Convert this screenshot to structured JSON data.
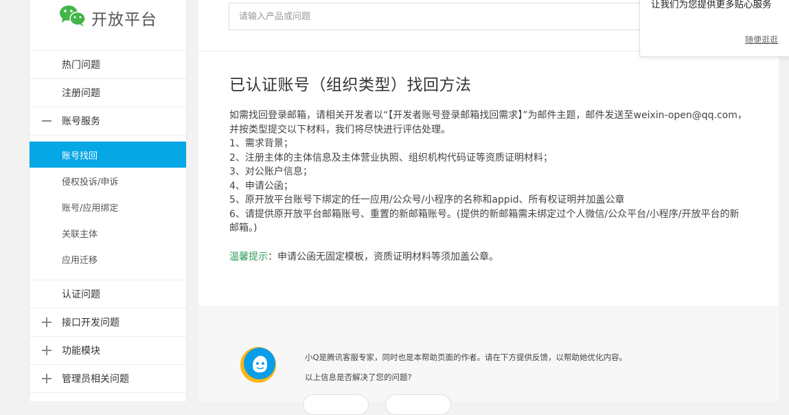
{
  "logo": {
    "text": "开放平台",
    "brand_color": "#44b549"
  },
  "sidebar": {
    "items": [
      {
        "label": "热门问题"
      },
      {
        "label": "注册问题"
      }
    ],
    "expanded": {
      "label": "账号服务",
      "sign": "minus-icon",
      "children": [
        {
          "label": "账号找回",
          "active": true
        },
        {
          "label": "侵权投诉/申诉"
        },
        {
          "label": "账号/应用绑定"
        },
        {
          "label": "关联主体"
        },
        {
          "label": "应用迁移"
        }
      ]
    },
    "after": [
      {
        "label": "认证问题"
      }
    ],
    "groups": [
      {
        "label": "接口开发问题",
        "sign": "plus-icon"
      },
      {
        "label": "功能模块",
        "sign": "plus-icon"
      },
      {
        "label": "管理员相关问题",
        "sign": "plus-icon"
      }
    ],
    "active_color": "#06a7e5"
  },
  "search": {
    "placeholder": "请输入产品或问题"
  },
  "article": {
    "title": "已认证账号（组织类型）找回方法",
    "lines": [
      "如需找回登录邮箱，请相关开发者以“【开发者账号登录邮箱找回需求】”为邮件主题，邮件发送至weixin-open@qq.com，并按类型提交以下材料，我们将尽快进行评估处理。",
      "1、需求背景；",
      "2、注册主体的主体信息及主体营业执照、组织机构代码证等资质证明材料；",
      "3、对公账户信息；",
      "4、申请公函；",
      "5、原开放平台账号下绑定的任一应用/公众号/小程序的名称和appid、所有权证明并加盖公章",
      "6、请提供原开放平台邮箱账号、重置的新邮箱账号。(提供的新邮箱需未绑定过个人微信/公众平台/小程序/开放平台的新邮箱。)"
    ],
    "tip_label": "温馨提示",
    "tip_text": "：申请公函无固定模板，资质证明材料等须加盖公章。",
    "tip_color": "#2e9a5c"
  },
  "feedback": {
    "text": "小Q是腾讯客服专家，同时也是本帮助页面的作者。请在下方提供反馈，以帮助她优化内容。",
    "question": "以上信息是否解决了您的问题?"
  },
  "popup": {
    "title": "让我们为您提供更多贴心服务",
    "link": "随便逛逛"
  }
}
